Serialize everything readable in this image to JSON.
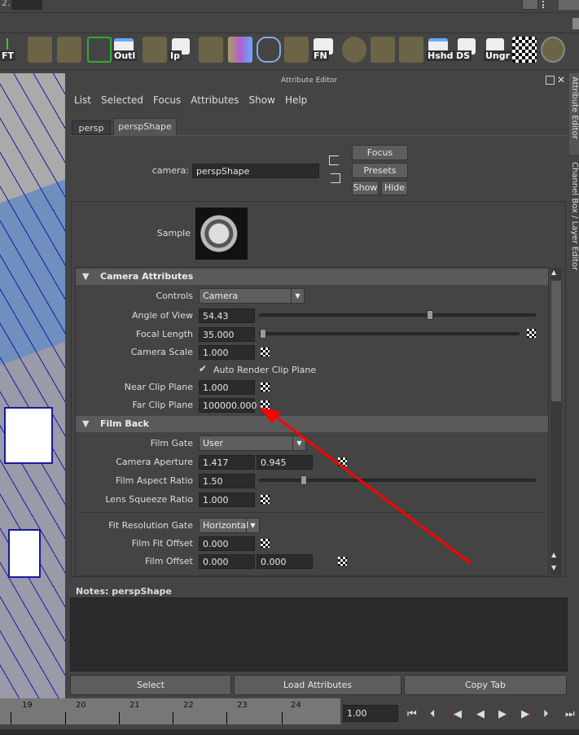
{
  "top": {
    "field_prefix": "2."
  },
  "shelf": [
    {
      "label": "FT"
    },
    {
      "label": "Outl"
    },
    {
      "label": "Ip"
    },
    {
      "label": "FN"
    },
    {
      "label": "Hshd"
    },
    {
      "label": "DS"
    },
    {
      "label": "Ungr"
    }
  ],
  "editor": {
    "title": "Attribute Editor",
    "menu": [
      "List",
      "Selected",
      "Focus",
      "Attributes",
      "Show",
      "Help"
    ],
    "tabs": [
      "persp",
      "perspShape"
    ],
    "camera_label": "camera:",
    "camera_value": "perspShape",
    "buttons": {
      "focus": "Focus",
      "presets": "Presets",
      "show": "Show",
      "hide": "Hide"
    },
    "sample_label": "Sample",
    "sections": {
      "camera": "Camera Attributes",
      "film": "Film Back"
    },
    "controls_label": "Controls",
    "controls_value": "Camera",
    "angle_label": "Angle of View",
    "angle_value": "54.43",
    "angle_slider": 0.62,
    "focal_label": "Focal Length",
    "focal_value": "35.000",
    "focal_slider": 0.0,
    "scale_label": "Camera Scale",
    "scale_value": "1.000",
    "auto_clip_label": "Auto Render Clip Plane",
    "auto_clip_checked": true,
    "near_label": "Near Clip Plane",
    "near_value": "1.000",
    "far_label": "Far Clip Plane",
    "far_value": "100000.000",
    "gate_label": "Film Gate",
    "gate_value": "User",
    "aperture_label": "Camera Aperture",
    "aperture_x": "1.417",
    "aperture_y": "0.945",
    "aspect_label": "Film Aspect Ratio",
    "aspect_value": "1.50",
    "aspect_slider": 0.15,
    "squeeze_label": "Lens Squeeze Ratio",
    "squeeze_value": "1.000",
    "fitgate_label": "Fit Resolution Gate",
    "fitgate_value": "Horizontal",
    "fitoffset_label": "Film Fit Offset",
    "fitoffset_value": "0.000",
    "offset_label": "Film Offset",
    "offset_x": "0.000",
    "offset_y": "0.000",
    "notes_label": "Notes:  perspShape",
    "bottom": {
      "select": "Select",
      "load": "Load Attributes",
      "copy": "Copy Tab"
    }
  },
  "side_tabs": [
    "Attribute Editor",
    "Channel Box / Layer Editor"
  ],
  "timeline": {
    "ticks": [
      "19",
      "20",
      "21",
      "22",
      "23",
      "24"
    ],
    "current": "1.00"
  },
  "colors": {
    "annotation_arrow": "#ff0000",
    "viewport_sky": "#6f8fbf",
    "wire": "#1a1a9a"
  }
}
